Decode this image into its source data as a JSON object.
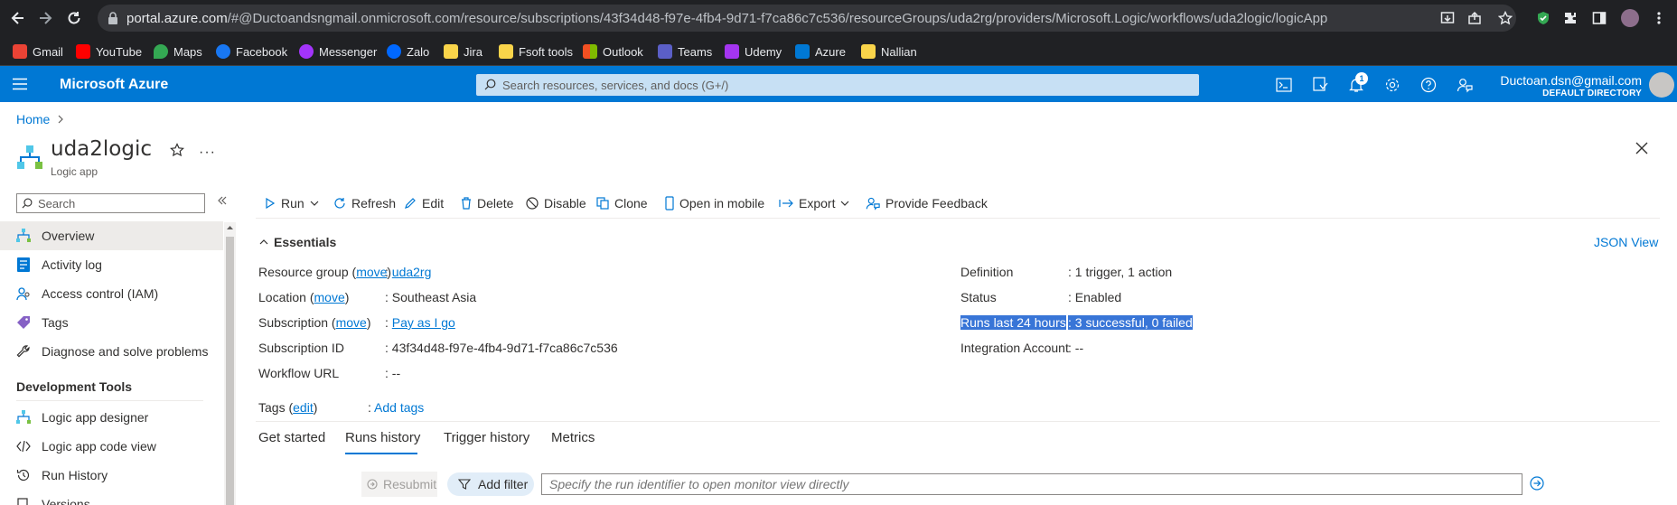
{
  "browser": {
    "url_host": "portal.azure.com",
    "url_path": "/#@Ductoandsngmail.onmicrosoft.com/resource/subscriptions/43f34d48-f97e-4fb4-9d71-f7ca86c7c536/resourceGroups/uda2rg/providers/Microsoft.Logic/workflows/uda2logic/logicApp",
    "bookmarks": [
      {
        "label": "Gmail",
        "color": "#ea4335"
      },
      {
        "label": "YouTube",
        "color": "#ff0000"
      },
      {
        "label": "Maps",
        "color": "#34a853"
      },
      {
        "label": "Facebook",
        "color": "#1877f2"
      },
      {
        "label": "Messenger",
        "color": "#a334fa"
      },
      {
        "label": "Zalo",
        "color": "#0068ff"
      },
      {
        "label": "Jira",
        "color": "#f9d44a"
      },
      {
        "label": "Fsoft tools",
        "color": "#f9d44a"
      },
      {
        "label": "Outlook",
        "color": "#f25022"
      },
      {
        "label": "Teams",
        "color": "#5b5fc7"
      },
      {
        "label": "Udemy",
        "color": "#a435f0"
      },
      {
        "label": "Azure",
        "color": "#0078d4"
      },
      {
        "label": "Nallian",
        "color": "#f9d44a"
      }
    ]
  },
  "header": {
    "brand": "Microsoft Azure",
    "search_placeholder": "Search resources, services, and docs (G+/)",
    "notification_count": "1",
    "user_email": "Ductoan.dsn@gmail.com",
    "user_directory": "DEFAULT DIRECTORY"
  },
  "blade": {
    "breadcrumb_home": "Home",
    "title": "uda2logic",
    "subtitle": "Logic app"
  },
  "sidebar": {
    "search_placeholder": "Search",
    "items": [
      {
        "label": "Overview",
        "icon": "logic-app-icon"
      },
      {
        "label": "Activity log",
        "icon": "activity-log-icon"
      },
      {
        "label": "Access control (IAM)",
        "icon": "iam-icon"
      },
      {
        "label": "Tags",
        "icon": "tag-icon"
      },
      {
        "label": "Diagnose and solve problems",
        "icon": "wrench-icon"
      }
    ],
    "section_title": "Development Tools",
    "dev_items": [
      {
        "label": "Logic app designer",
        "icon": "designer-icon"
      },
      {
        "label": "Logic app code view",
        "icon": "code-icon"
      },
      {
        "label": "Run History",
        "icon": "history-icon"
      },
      {
        "label": "Versions",
        "icon": "versions-icon"
      }
    ]
  },
  "commands": {
    "run": "Run",
    "refresh": "Refresh",
    "edit": "Edit",
    "delete": "Delete",
    "disable": "Disable",
    "clone": "Clone",
    "open_mobile": "Open in mobile",
    "export": "Export",
    "feedback": "Provide Feedback"
  },
  "essentials": {
    "title": "Essentials",
    "json_view": "JSON View",
    "move": "move",
    "left": {
      "resource_group_label": "Resource group",
      "resource_group_value": "uda2rg",
      "location_label": "Location",
      "location_value": "Southeast Asia",
      "subscription_label": "Subscription",
      "subscription_value": "Pay as I go",
      "subscription_id_label": "Subscription ID",
      "subscription_id_value": "43f34d48-f97e-4fb4-9d71-f7ca86c7c536",
      "workflow_url_label": "Workflow URL",
      "workflow_url_value": "--"
    },
    "right": {
      "definition_label": "Definition",
      "definition_value": "1 trigger, 1 action",
      "status_label": "Status",
      "status_value": "Enabled",
      "runs_label": "Runs last 24 hours",
      "runs_value": "3 successful, 0 failed",
      "integration_label": "Integration Account",
      "integration_value": "--"
    },
    "tags_label": "Tags",
    "tags_edit": "edit",
    "add_tags": "Add tags"
  },
  "tabs": [
    "Get started",
    "Runs history",
    "Trigger history",
    "Metrics"
  ],
  "active_tab": "Runs history",
  "runs": {
    "resubmit": "Resubmit",
    "add_filter": "Add filter",
    "run_id_placeholder": "Specify the run identifier to open monitor view directly"
  }
}
